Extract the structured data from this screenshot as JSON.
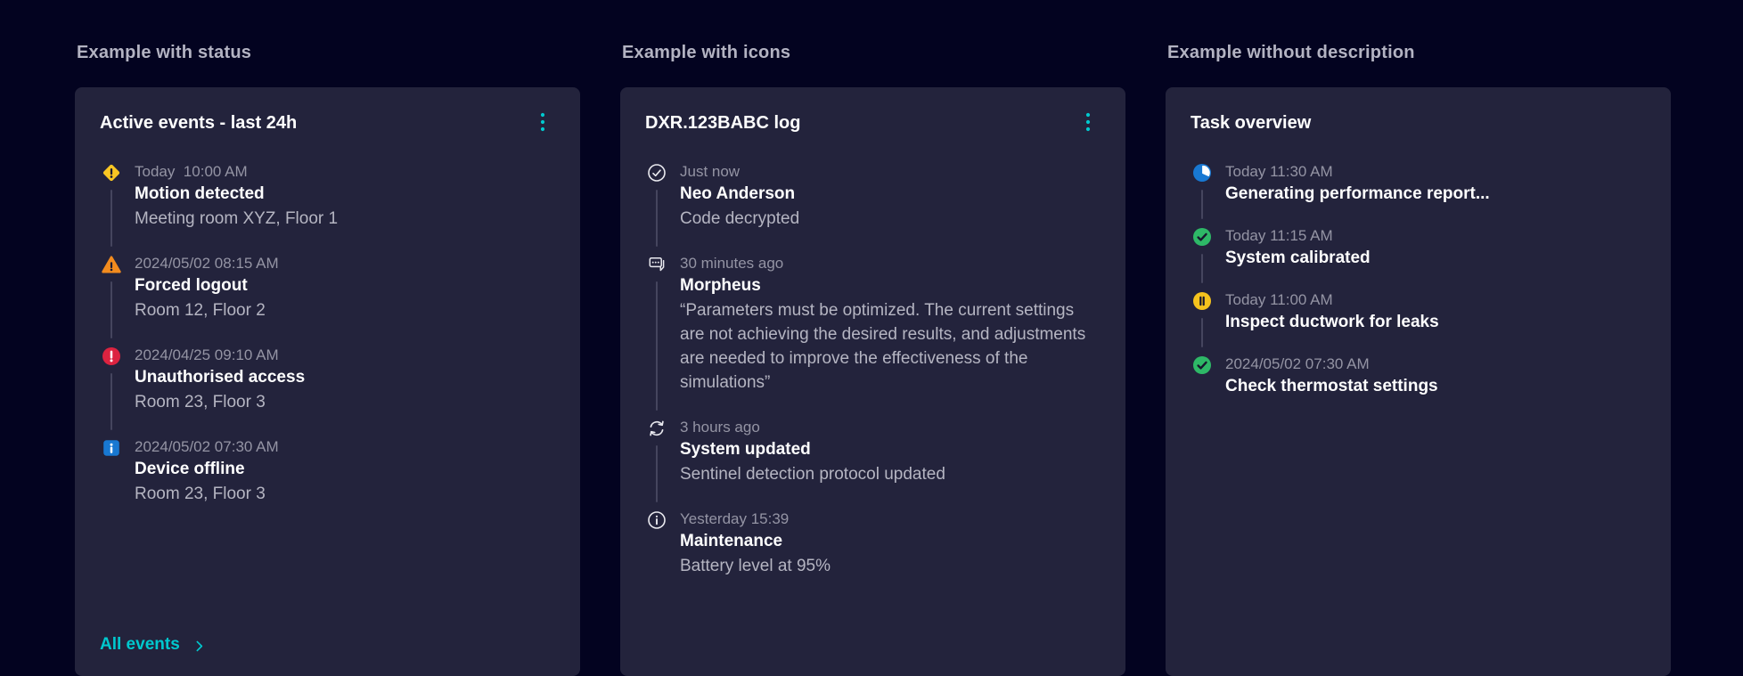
{
  "colors": {
    "page_background": "#030320",
    "card_background": "#23233C",
    "accent_cyan": "#00C8CE",
    "title_white": "#FFFFFF",
    "section_label_gray": "#B3B3C2",
    "time_gray": "#9494A4",
    "description_gray": "#B5B5C2",
    "connector_gray": "#45455E",
    "status_yellow": "#F9C623",
    "status_orange": "#F28B1E",
    "status_red": "#DC2340",
    "status_blue": "#1878D2",
    "status_green": "#2EB867",
    "icon_dark": "#17172E",
    "icon_outline": "#E9E9EF"
  },
  "sections": [
    {
      "label": "Example with status",
      "card": {
        "title": "Active events - last 24h",
        "menu_icon": "kebab-menu-icon",
        "items": [
          {
            "icon": "warning-diamond-icon",
            "time": "Today  10:00 AM",
            "title": "Motion detected",
            "description": "Meeting room XYZ, Floor 1"
          },
          {
            "icon": "warning-triangle-icon",
            "time": "2024/05/02 08:15 AM",
            "title": "Forced logout",
            "description": "Room 12, Floor 2"
          },
          {
            "icon": "error-circle-icon",
            "time": "2024/04/25 09:10 AM",
            "title": "Unauthorised access",
            "description": "Room 23, Floor 3"
          },
          {
            "icon": "info-square-icon",
            "time": "2024/05/02 07:30 AM",
            "title": "Device offline",
            "description": "Room 23, Floor 3"
          }
        ],
        "footer_link": "All events"
      }
    },
    {
      "label": "Example with icons",
      "card": {
        "title": "DXR.123BABC log",
        "menu_icon": "kebab-menu-icon",
        "items": [
          {
            "icon": "check-circle-icon",
            "time": "Just now",
            "title": "Neo Anderson",
            "description": "Code decrypted"
          },
          {
            "icon": "chat-bubble-icon",
            "time": "30 minutes ago",
            "title": "Morpheus",
            "description": "“Parameters must be optimized. The current settings are not achieving the desired results, and adjustments are needed to improve the effectiveness of the simulations”"
          },
          {
            "icon": "sync-icon",
            "time": "3 hours ago",
            "title": "System updated",
            "description": "Sentinel detection protocol updated"
          },
          {
            "icon": "info-circle-icon",
            "time": "Yesterday 15:39",
            "title": "Maintenance",
            "description": "Battery level at 95%"
          }
        ]
      }
    },
    {
      "label": "Example without description",
      "card": {
        "title": "Task overview",
        "items": [
          {
            "icon": "in-progress-icon",
            "time": "Today 11:30 AM",
            "title": "Generating performance report..."
          },
          {
            "icon": "success-circle-icon",
            "time": "Today 11:15 AM",
            "title": "System calibrated"
          },
          {
            "icon": "paused-circle-icon",
            "time": "Today 11:00 AM",
            "title": "Inspect ductwork for leaks"
          },
          {
            "icon": "success-circle-icon",
            "time": "2024/05/02 07:30 AM",
            "title": "Check thermostat settings"
          }
        ]
      }
    }
  ]
}
